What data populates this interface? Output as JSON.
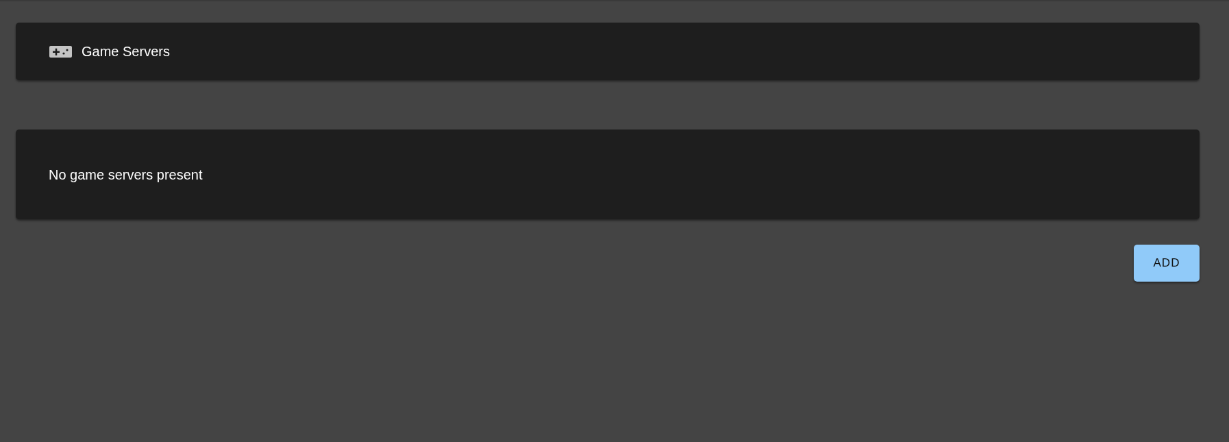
{
  "header": {
    "title": "Game Servers"
  },
  "servers_panel": {
    "empty_message": "No game servers present"
  },
  "actions": [
    {
      "label": "ADD"
    }
  ]
}
